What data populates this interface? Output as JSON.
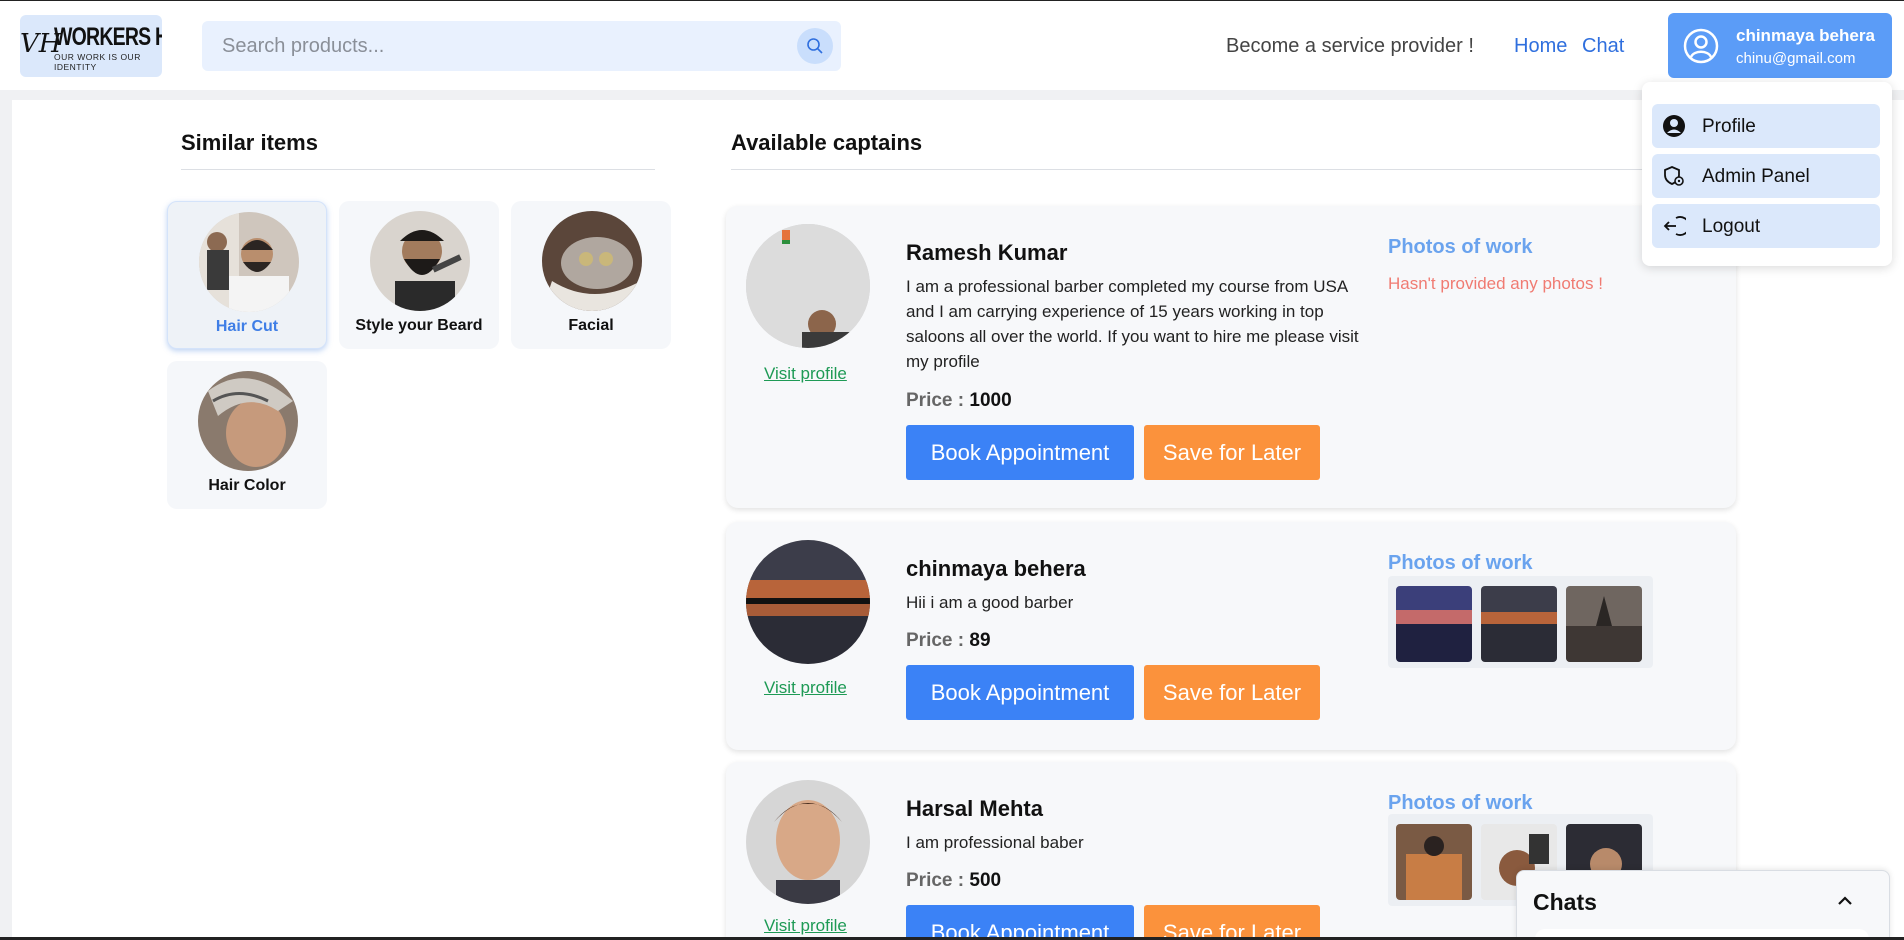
{
  "header": {
    "logo": {
      "mark": "VH",
      "name": "WORKERS HIVE",
      "tagline": "OUR WORK IS OUR IDENTITY"
    },
    "search": {
      "placeholder": "Search products..."
    },
    "become_provider": "Become a service provider !",
    "nav": {
      "home": "Home",
      "chat": "Chat"
    },
    "user": {
      "name": "chinmaya behera",
      "email": "chinu@gmail.com"
    }
  },
  "user_menu": {
    "items": [
      {
        "label": "Profile",
        "icon": "user-circle-icon"
      },
      {
        "label": "Admin Panel",
        "icon": "admin-shield-icon"
      },
      {
        "label": "Logout",
        "icon": "logout-icon"
      }
    ]
  },
  "similar": {
    "title": "Similar items",
    "items": [
      {
        "label": "Hair Cut",
        "active": true
      },
      {
        "label": "Style your Beard",
        "active": false
      },
      {
        "label": "Facial",
        "active": false
      },
      {
        "label": "Hair Color",
        "active": false
      }
    ]
  },
  "captains": {
    "title": "Available captains",
    "visit_label": "Visit profile",
    "price_label": "Price :",
    "book_label": "Book Appointment",
    "save_label": "Save for Later",
    "photos_label": "Photos of work",
    "no_photos": "Hasn't provided any photos !",
    "list": [
      {
        "name": "Ramesh Kumar",
        "description": "I am a professional barber completed my course from USA and I am carrying experience of 15 years working in top saloons all over the world. If you want to hire me please visit my profile",
        "price": "1000",
        "photos": 0
      },
      {
        "name": "chinmaya behera",
        "description": "Hii i am a good barber",
        "price": "89",
        "photos": 3
      },
      {
        "name": "Harsal Mehta",
        "description": "I am professional baber",
        "price": "500",
        "photos": 3
      }
    ]
  },
  "chats": {
    "title": "Chats"
  },
  "colors": {
    "primary": "#3b82f6",
    "accent": "#fb923c",
    "link_green": "#1e9a55",
    "user_bg": "#5b9cf7"
  }
}
